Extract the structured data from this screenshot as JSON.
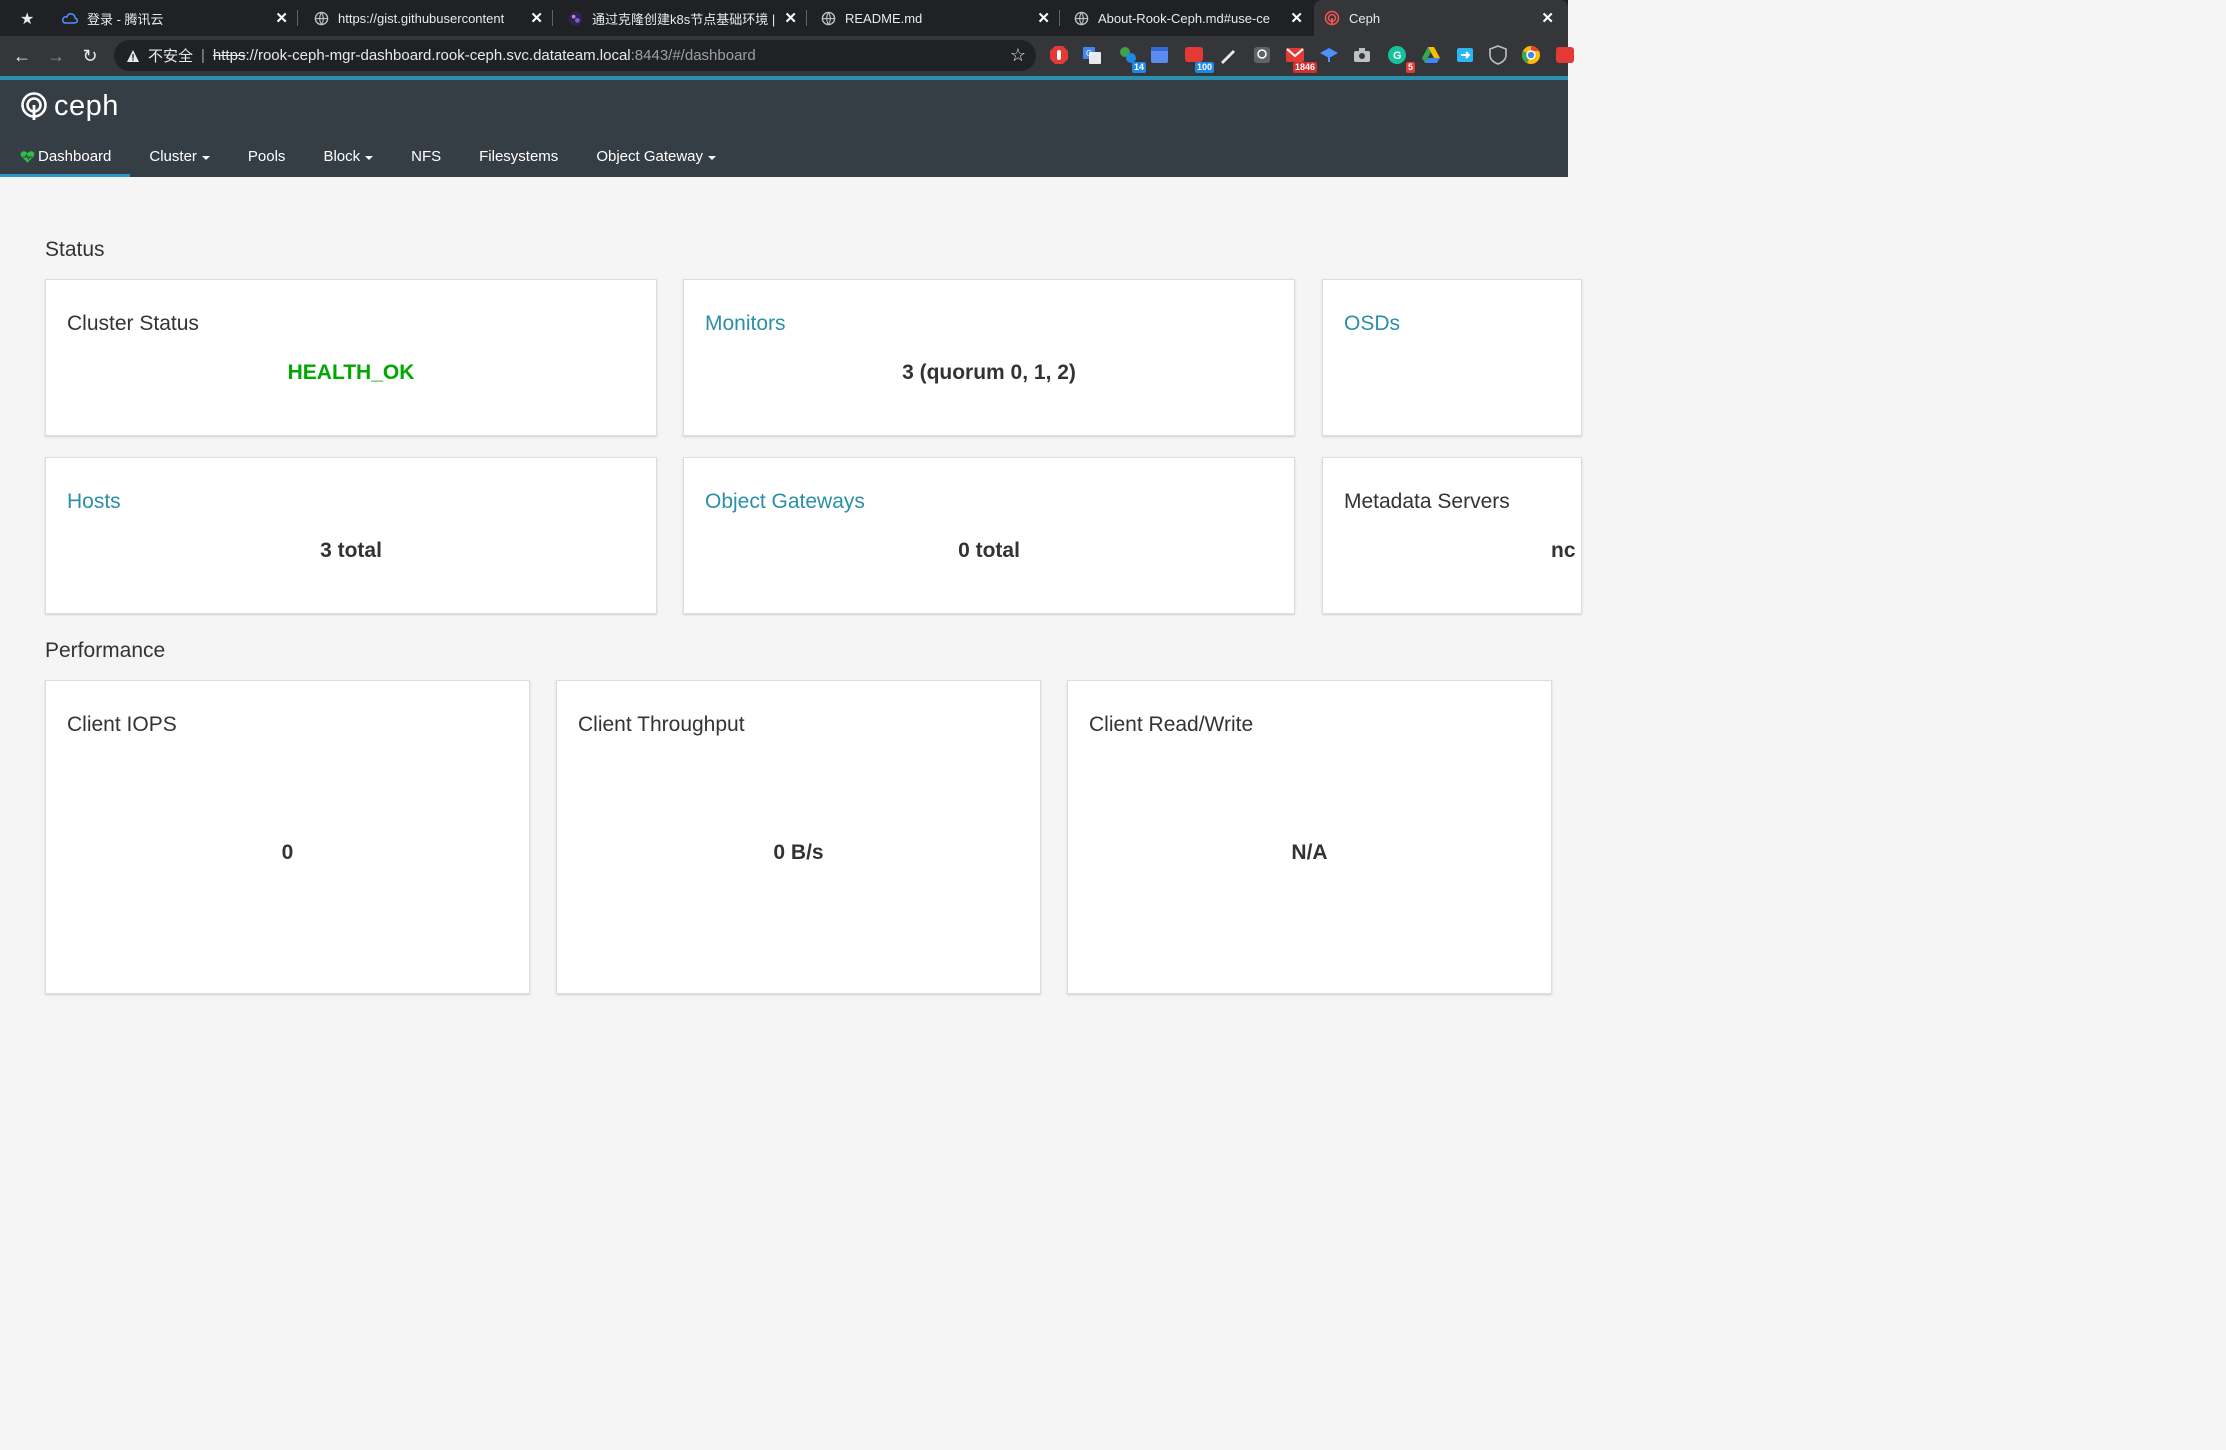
{
  "browser": {
    "tabs": [
      {
        "title": "登录 - 腾讯云",
        "icon": "cloud-icon"
      },
      {
        "title": "https://gist.githubusercontent",
        "icon": "globe-icon"
      },
      {
        "title": "通过克隆创建k8s节点基础环境 |",
        "icon": "avatar-icon"
      },
      {
        "title": "README.md",
        "icon": "globe-icon"
      },
      {
        "title": "About-Rook-Ceph.md#use-ce",
        "icon": "globe-icon"
      },
      {
        "title": "Ceph",
        "icon": "ceph-icon"
      }
    ],
    "address": {
      "security_label": "不安全",
      "scheme": "https",
      "host": "://rook-ceph-mgr-dashboard.rook-ceph.svc.datateam.local",
      "path": ":8443/#/dashboard"
    },
    "extension_badges": [
      "14",
      "100",
      "1846",
      "5"
    ]
  },
  "ceph": {
    "logo_text": "ceph",
    "nav": [
      {
        "label": "Dashboard",
        "dropdown": false,
        "active": true
      },
      {
        "label": "Cluster",
        "dropdown": true
      },
      {
        "label": "Pools",
        "dropdown": false
      },
      {
        "label": "Block",
        "dropdown": true
      },
      {
        "label": "NFS",
        "dropdown": false
      },
      {
        "label": "Filesystems",
        "dropdown": false
      },
      {
        "label": "Object Gateway",
        "dropdown": true
      }
    ]
  },
  "status": {
    "heading": "Status",
    "cards": {
      "cluster_status": {
        "title": "Cluster Status",
        "value": "HEALTH_OK"
      },
      "monitors": {
        "title": "Monitors",
        "value": "3 (quorum 0, 1, 2)"
      },
      "osds": {
        "title": "OSDs"
      },
      "hosts": {
        "title": "Hosts",
        "value": "3 total"
      },
      "object_gateways": {
        "title": "Object Gateways",
        "value": "0 total"
      },
      "metadata_servers": {
        "title": "Metadata Servers",
        "value": "nc"
      }
    }
  },
  "performance": {
    "heading": "Performance",
    "cards": {
      "client_iops": {
        "title": "Client IOPS",
        "value": "0"
      },
      "client_throughput": {
        "title": "Client Throughput",
        "value": "0 B/s"
      },
      "client_read_write": {
        "title": "Client Read/Write",
        "value": "N/A"
      }
    }
  },
  "colors": {
    "health_ok": "#00a800",
    "link": "#2b8fa6",
    "navbar": "#363e45",
    "accent": "#2b97c8"
  }
}
